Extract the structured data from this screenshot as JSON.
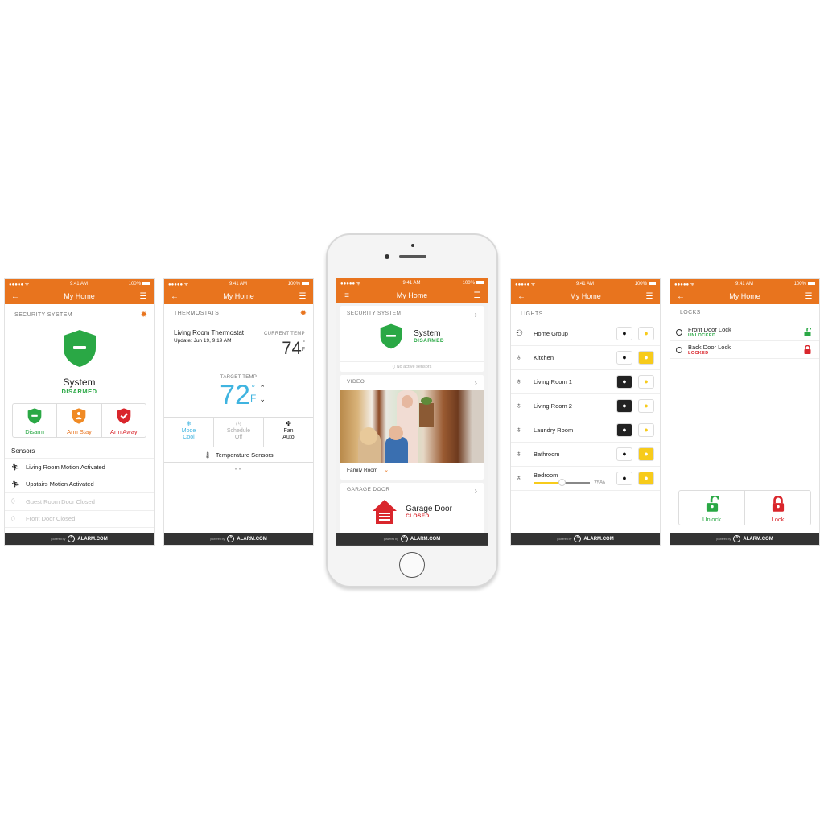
{
  "status_bar": {
    "carrier": "●●●●● ᯤ",
    "time": "9:41 AM",
    "battery": "100%"
  },
  "nav_title": "My Home",
  "brand": {
    "powered_by": "powered by",
    "name": "ALARM.COM",
    "accent": "#e8741e",
    "green": "#2aa845",
    "red": "#d9262c",
    "yellow": "#f7cb1b",
    "blue": "#3fb4e0"
  },
  "security": {
    "header": "SECURITY SYSTEM",
    "system_label": "System",
    "state": "DISARMED",
    "buttons": [
      {
        "label": "Disarm",
        "icon": "shield-minus-icon"
      },
      {
        "label": "Arm Stay",
        "icon": "shield-person-icon"
      },
      {
        "label": "Arm Away",
        "icon": "shield-check-icon"
      }
    ],
    "sensors_title": "Sensors",
    "sensors": [
      {
        "label": "Living Room Motion Activated",
        "icon": "motion-icon",
        "active": true
      },
      {
        "label": "Upstairs Motion Activated",
        "icon": "motion-icon",
        "active": true
      },
      {
        "label": "Guest Room Door Closed",
        "icon": "door-sensor-icon",
        "active": false
      },
      {
        "label": "Front Door Closed",
        "icon": "door-sensor-icon",
        "active": false
      }
    ]
  },
  "thermostat": {
    "header": "THERMOSTATS",
    "name": "Living Room Thermostat",
    "update": "Update: Jun 19, 9:19 AM",
    "current_label": "CURRENT TEMP",
    "current_value": "74",
    "unit_deg": "°",
    "unit_f": "F",
    "target_label": "TARGET TEMP",
    "target_value": "72",
    "modes": [
      {
        "title": "Mode",
        "value": "Cool",
        "icon": "snowflake-icon"
      },
      {
        "title": "Schedule",
        "value": "Off",
        "icon": "clock-icon"
      },
      {
        "title": "Fan",
        "value": "Auto",
        "icon": "fan-icon"
      }
    ],
    "sensors_link": "Temperature Sensors",
    "page_index": 1,
    "page_count": 2
  },
  "dashboard": {
    "security_header": "SECURITY SYSTEM",
    "system_label": "System",
    "state": "DISARMED",
    "no_sensors": "No active sensors",
    "video_header": "VIDEO",
    "camera": "Family Room",
    "garage_header": "GARAGE DOOR",
    "garage_label": "Garage Door",
    "garage_state": "CLOSED"
  },
  "lights": {
    "header": "LIGHTS",
    "items": [
      {
        "name": "Home Group",
        "icon": "bulb-group-icon",
        "off_active": false,
        "on_active": false
      },
      {
        "name": "Kitchen",
        "icon": "bulb-icon",
        "off_active": false,
        "on_active": true
      },
      {
        "name": "Living Room 1",
        "icon": "bulb-icon",
        "off_active": true,
        "on_active": false
      },
      {
        "name": "Living Room 2",
        "icon": "bulb-icon",
        "off_active": true,
        "on_active": false
      },
      {
        "name": "Laundry Room",
        "icon": "bulb-icon",
        "off_active": true,
        "on_active": false
      },
      {
        "name": "Bathroom",
        "icon": "bulb-icon",
        "off_active": false,
        "on_active": true
      },
      {
        "name": "Bedroom",
        "icon": "bulb-icon",
        "off_active": false,
        "on_active": true,
        "dimmer": 75,
        "dimmer_label": "75%"
      }
    ]
  },
  "locks": {
    "header": "LOCKS",
    "items": [
      {
        "name": "Front Door Lock",
        "state": "UNLOCKED",
        "locked": false
      },
      {
        "name": "Back Door Lock",
        "state": "LOCKED",
        "locked": true
      }
    ],
    "unlock_label": "Unlock",
    "lock_label": "Lock"
  }
}
